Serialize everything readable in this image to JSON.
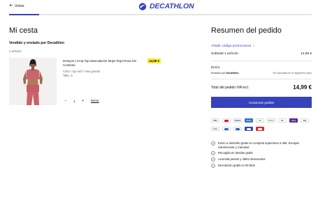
{
  "header": {
    "back_label": "Volver",
    "logo_text": "DECATHLON"
  },
  "progress": {
    "fraction": 0.1
  },
  "cart": {
    "title": "Mi cesta",
    "sold_by": "Vendido y enviado por Decathlon",
    "item_count": "1 artículo",
    "item": {
      "name": "Domyos | Crop-Top Musculación Mujer Rojo-Rosa Sin Costuras",
      "color": "Color: rojo rubí / rosa granito",
      "size": "Talla: S",
      "price": "14,99 €",
      "quantity": "1",
      "minus": "−",
      "plus": "+",
      "remove_label": "Borrar"
    }
  },
  "summary": {
    "title": "Resumen del pedido",
    "promo_label": "Añadir código promocional",
    "subtotal_label": "Subtotal 1 artículo",
    "subtotal_value": "14,99 €",
    "shipping_title": "Envío",
    "shipping_by_prefix": "Enviado por ",
    "shipping_by_brand": "Decathlon",
    "shipping_note": "Se calculará en el siguiente paso",
    "total_label": "Total del pedido IVA incl.",
    "total_value": "14,99 €",
    "cta_label": "Comenzar pedido"
  },
  "payment_methods": [
    {
      "name": "VISA",
      "color": "#1a1f71",
      "bg": "#ffffff"
    },
    {
      "name": "",
      "color": "#eb001b",
      "bg": "#ffffff"
    },
    {
      "name": "PayPal",
      "color": "#003087",
      "bg": "#ffffff"
    },
    {
      "name": "Amex",
      "color": "#ffffff",
      "bg": "#2e77bc"
    },
    {
      "name": "CB",
      "color": "#1a9a4b",
      "bg": "#ffffff"
    },
    {
      "name": "SCRAY",
      "color": "#3aa757",
      "bg": "#ffffff"
    },
    {
      "name": "KL",
      "color": "#222222",
      "bg": "#ffffff"
    },
    {
      "name": "oney",
      "color": "#ffffff",
      "bg": "#5b2d8e"
    },
    {
      "name": "Pay",
      "color": "#111111",
      "bg": "#ffffff"
    },
    {
      "name": "GPay",
      "color": "#555555",
      "bg": "#ffffff"
    },
    {
      "name": "",
      "color": "#2b62c0",
      "bg": "#ffffff"
    },
    {
      "name": "",
      "color": "#1d5fbf",
      "bg": "#ffffff"
    },
    {
      "name": "",
      "color": "#ffffff",
      "bg": "#2b4ea0"
    },
    {
      "name": "",
      "color": "#ffffff",
      "bg": "#d92c2c"
    }
  ],
  "benefits": [
    "Envío a domicilio gratis en compras superiores a 40€. Excepto voluminosos y Canarias",
    "Recogida en tiendas gratis",
    "Acumula puntos y obtén descuentos",
    "Devolución gratis en 60 días"
  ],
  "colors": {
    "brand": "#3643ba",
    "price_badge": "#ffea28"
  },
  "icons": [
    "arrow-left-icon",
    "decathlon-logo-icon",
    "chevron-right-icon",
    "check-circle-icon"
  ]
}
